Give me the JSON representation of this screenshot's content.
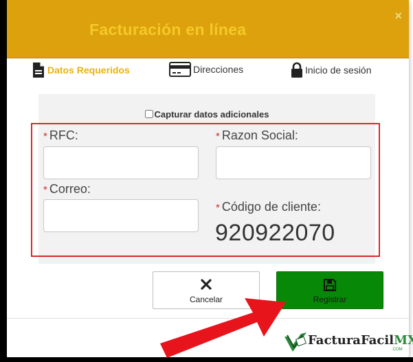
{
  "header": {
    "title": "Facturación en línea",
    "close": "×"
  },
  "steps": [
    {
      "label": "Datos Requeridos",
      "icon": "document-icon",
      "active": true
    },
    {
      "label": "Direcciones",
      "icon": "credit-card-icon",
      "active": false
    },
    {
      "label": "Inicio de sesión",
      "icon": "lock-icon",
      "active": false
    }
  ],
  "form": {
    "capture_label": "Capturar datos adicionales",
    "required_mark": "*",
    "rfc_label": "RFC:",
    "razon_label": "Razon Social:",
    "correo_label": "Correo:",
    "codigo_label": "Código de cliente:",
    "codigo_value": "920922070",
    "rfc_value": "",
    "razon_value": "",
    "correo_value": ""
  },
  "buttons": {
    "cancel": "Cancelar",
    "register": "Registrar"
  },
  "logo": {
    "brand": "FacturaFacil",
    "suffix": "MX",
    "domain": ".COM"
  },
  "colors": {
    "header": "#dca10c",
    "title": "#f5c928",
    "active_step": "#e8b20f",
    "required": "#d9262c",
    "register_btn": "#078807",
    "annotation_arrow": "#e8141c"
  }
}
